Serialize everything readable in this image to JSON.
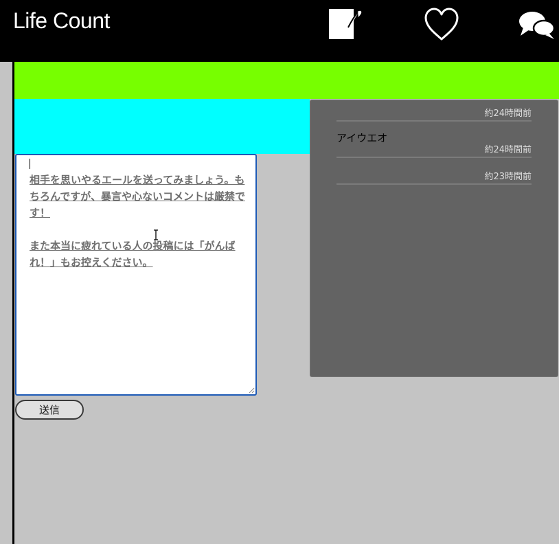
{
  "app": {
    "title": "Life Count"
  },
  "colors": {
    "header_bg": "#000000",
    "green_band": "#77ff00",
    "cyan_band": "#00ffff",
    "page_bg": "#c4c4c4",
    "panel_bg": "#636363",
    "textarea_border": "#1d5ab6"
  },
  "nav": {
    "icons": [
      "write-icon",
      "heart-icon",
      "chat-bubbles-icon"
    ]
  },
  "compose": {
    "placeholder": "相手を思いやるエールを送ってみましょう。もちろんですが、暴言や心ないコメントは厳禁です！\n\nまた本当に疲れている人の投稿には「がんばれ！」もお控えください。",
    "submit_label": "送信"
  },
  "comments": [
    {
      "text": "",
      "time": "約24時間前"
    },
    {
      "text": "アイウエオ",
      "time": "約24時間前"
    },
    {
      "text": "",
      "time": "約23時間前"
    }
  ]
}
